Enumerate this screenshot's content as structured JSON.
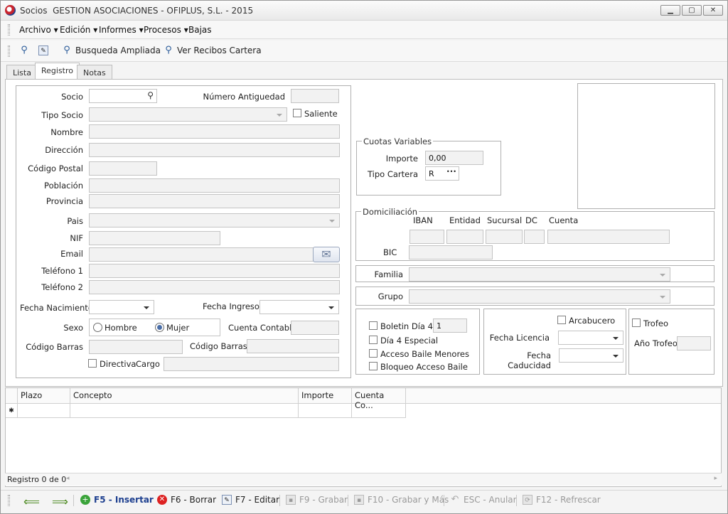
{
  "window": {
    "title_prefix": "Socios",
    "title_company": "GESTION ASOCIACIONES - OFIPLUS, S.L. - 2015",
    "min": "▁",
    "max": "▢",
    "close": "✕"
  },
  "menu": [
    "Archivo",
    "Edición",
    "Informes",
    "Procesos",
    "Bajas"
  ],
  "toolbar": {
    "busqueda": "Busqueda Ampliada",
    "ver_recibos": "Ver Recibos Cartera"
  },
  "tabs": [
    "Lista",
    "Registro",
    "Notas"
  ],
  "form": {
    "socio_label": "Socio",
    "socio_value": "",
    "numero_antiguedad_label": "Número Antiguedad",
    "tipo_socio_label": "Tipo Socio",
    "saliente_label": "Saliente",
    "nombre_label": "Nombre",
    "direccion_label": "Dirección",
    "codigo_postal_label": "Código Postal",
    "poblacion_label": "Población",
    "provincia_label": "Provincia",
    "pais_label": "Pais",
    "nif_label": "NIF",
    "email_label": "Email",
    "telefono1_label": "Teléfono 1",
    "telefono2_label": "Teléfono 2",
    "fecha_nacimiento_label": "Fecha Nacimiento",
    "fecha_ingreso_label": "Fecha Ingreso",
    "sexo_label": "Sexo",
    "hombre_label": "Hombre",
    "mujer_label": "Mujer",
    "cuenta_contable_label": "Cuenta Contable",
    "codigo_barras_label": "Código Barras",
    "codigo_barras2_label": "Código Barras",
    "directiva_label": "Directiva",
    "cargo_label": "Cargo"
  },
  "cuotas": {
    "title": "Cuotas Variables",
    "importe_label": "Importe",
    "importe_value": "0,00",
    "tipo_cartera_label": "Tipo Cartera",
    "tipo_cartera_value": "R",
    "ellipsis": "•••"
  },
  "domiciliacion": {
    "title": "Domiciliación",
    "iban": "IBAN",
    "entidad": "Entidad",
    "sucursal": "Sucursal",
    "dc": "DC",
    "cuenta": "Cuenta",
    "bic": "BIC"
  },
  "familia_label": "Familia",
  "grupo_label": "Grupo",
  "opciones": {
    "boletin_label": "Boletin Día 4",
    "boletin_value": "1",
    "dia4_label": "Día 4 Especial",
    "acceso_label": "Acceso Baile Menores",
    "bloqueo_label": "Bloqueo Acceso Baile"
  },
  "licencia": {
    "arcabucero_label": "Arcabucero",
    "fecha_licencia_label": "Fecha Licencia",
    "fecha_caducidad_label": "Fecha Caducidad"
  },
  "trofeo": {
    "trofeo_label": "Trofeo",
    "anio_label": "Año Trofeo"
  },
  "grid": {
    "columns": [
      "Plazo",
      "Concepto",
      "Importe",
      "Cuenta Co..."
    ],
    "new_row_marker": "✱"
  },
  "status": {
    "text": "Registro 0 de 0"
  },
  "bottom": {
    "insertar": "F5 - Insertar",
    "borrar": "F6 - Borrar",
    "editar": "F7 - Editar",
    "grabar": "F9 - Grabar",
    "grabar_mas": "F10 - Grabar y Más",
    "anular": "ESC - Anular",
    "refrescar": "F12 - Refrescar"
  }
}
